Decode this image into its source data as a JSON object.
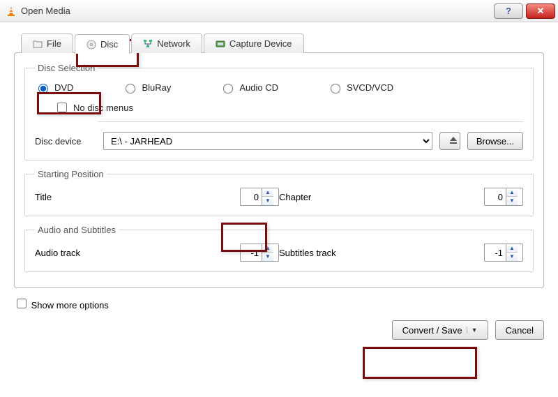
{
  "window_title": "Open Media",
  "tabs": {
    "file": "File",
    "disc": "Disc",
    "network": "Network",
    "capture": "Capture Device"
  },
  "disc_selection": {
    "legend": "Disc Selection",
    "dvd": "DVD",
    "bluray": "BluRay",
    "audiocd": "Audio CD",
    "svcd": "SVCD/VCD",
    "no_menus": "No disc menus",
    "device_label": "Disc device",
    "device_value": "E:\\ - JARHEAD",
    "browse": "Browse..."
  },
  "starting_position": {
    "legend": "Starting Position",
    "title_label": "Title",
    "title_value": "0",
    "chapter_label": "Chapter",
    "chapter_value": "0"
  },
  "audio_subtitles": {
    "legend": "Audio and Subtitles",
    "audio_label": "Audio track",
    "audio_value": "-1",
    "subs_label": "Subtitles track",
    "subs_value": "-1"
  },
  "show_more": "Show more options",
  "convert_save": "Convert / Save",
  "cancel": "Cancel"
}
